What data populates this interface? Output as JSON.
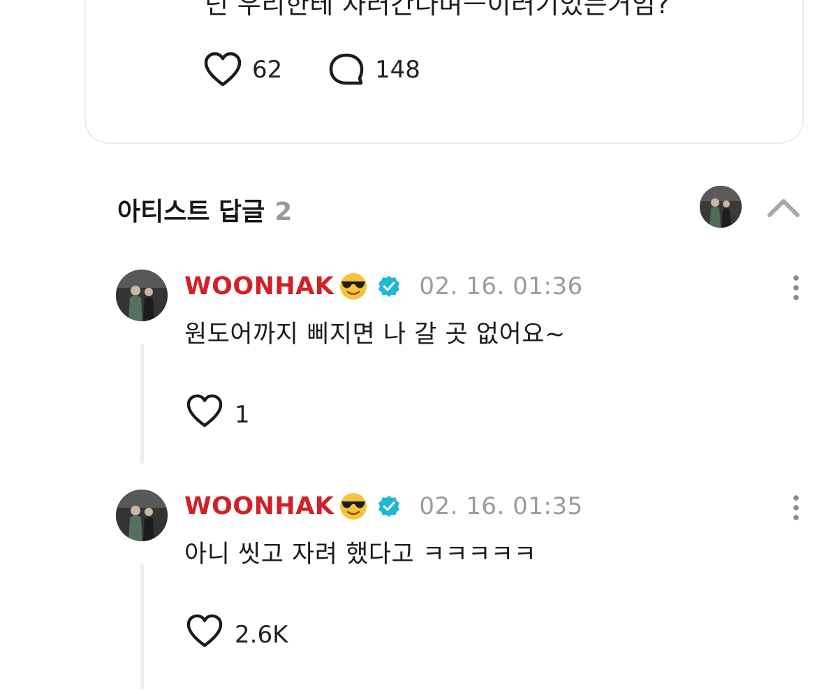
{
  "post": {
    "text": "넌 우리한테 자러간다며ㅡ이러기있는거임?",
    "likes": "62",
    "comments": "148"
  },
  "artist_replies": {
    "title": "아티스트 답글",
    "count": "2"
  },
  "replies": [
    {
      "author": "WOONHAK",
      "emoji": "smiling-face-with-sunglasses",
      "verified": true,
      "time": "02. 16. 01:36",
      "text": "원도어까지 삐지면 나 갈 곳 없어요~",
      "likes": "1"
    },
    {
      "author": "WOONHAK",
      "emoji": "smiling-face-with-sunglasses",
      "verified": true,
      "time": "02. 16. 01:35",
      "text": "아니 씻고 자려 했다고 ㅋㅋㅋㅋㅋ",
      "likes": "2.6K"
    }
  ],
  "colors": {
    "author_name": "#d32026",
    "verified_badge": "#1fb8d4",
    "muted": "#9b9b9b"
  }
}
